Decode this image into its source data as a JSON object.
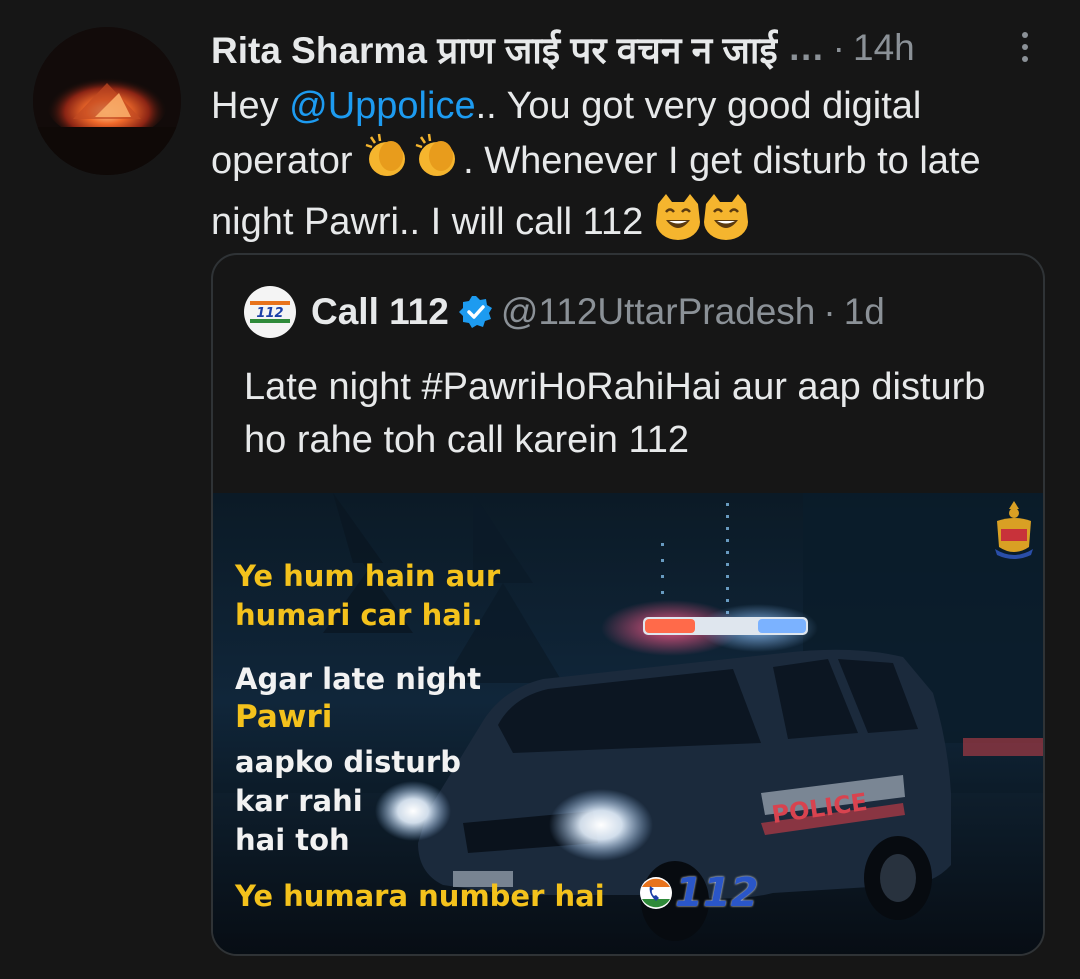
{
  "tweet": {
    "author_name": "Rita Sharma प्राण जाई पर वचन न जाई",
    "truncation": "…",
    "separator": "·",
    "time": "14h",
    "text_hey": "Hey ",
    "mention": "@Uppolice",
    "text_1": ".. You got very good digital operator ",
    "text_2": ". Whenever I get disturb to late night Pawri.. I will call 112 "
  },
  "quoted_tweet": {
    "name": "Call 112",
    "handle": "@112UttarPradesh",
    "separator": "·",
    "time": "1d",
    "text": "Late night #PawriHoRahiHai aur aap disturb ho rahe toh call karein 112",
    "avatar_text": "112"
  },
  "poster": {
    "line1a": "Ye hum hain aur",
    "line1b": "humari car hai.",
    "line2": "Agar late night",
    "line3": "Pawri",
    "line4a": "aapko disturb",
    "line4b": "kar rahi",
    "line4c": "hai toh",
    "line5": "Ye humara number hai",
    "number": "112",
    "car_label": "POLICE"
  },
  "icons": {
    "more": "more-vertical-icon",
    "verified": "verified-badge-icon",
    "clap": "clapping-hands-emoji",
    "cat": "grinning-cat-emoji"
  },
  "colors": {
    "background": "#161616",
    "text": "#e7e9ea",
    "muted": "#8b9197",
    "link": "#1d9bf0",
    "poster_yellow": "#f4c21c"
  }
}
